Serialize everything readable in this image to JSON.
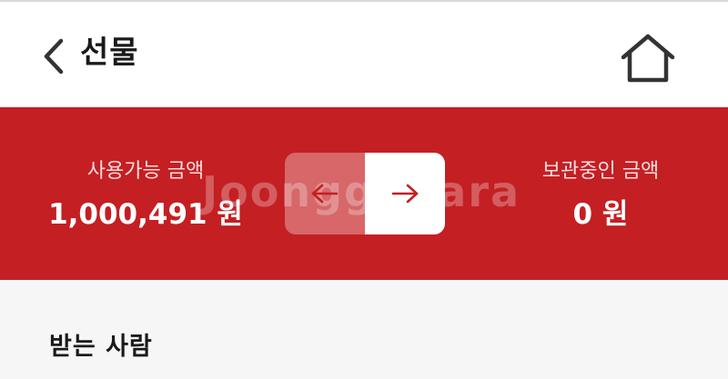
{
  "header": {
    "title": "선물",
    "back_icon": "chevron-left-icon",
    "home_icon": "home-icon"
  },
  "balances": {
    "available_label": "사용가능 금액",
    "available_value": "1,000,491 원",
    "stored_label": "보관중인 금액",
    "stored_value": "0 원"
  },
  "transfer": {
    "left_icon": "arrow-left-icon",
    "right_icon": "arrow-right-icon"
  },
  "watermark": "Joonggonara",
  "section": {
    "recipient_title": "받는 사람"
  },
  "colors": {
    "brand_red": "#c41f23",
    "text_dark": "#1a1a1a",
    "content_bg": "#f6f6f6"
  }
}
